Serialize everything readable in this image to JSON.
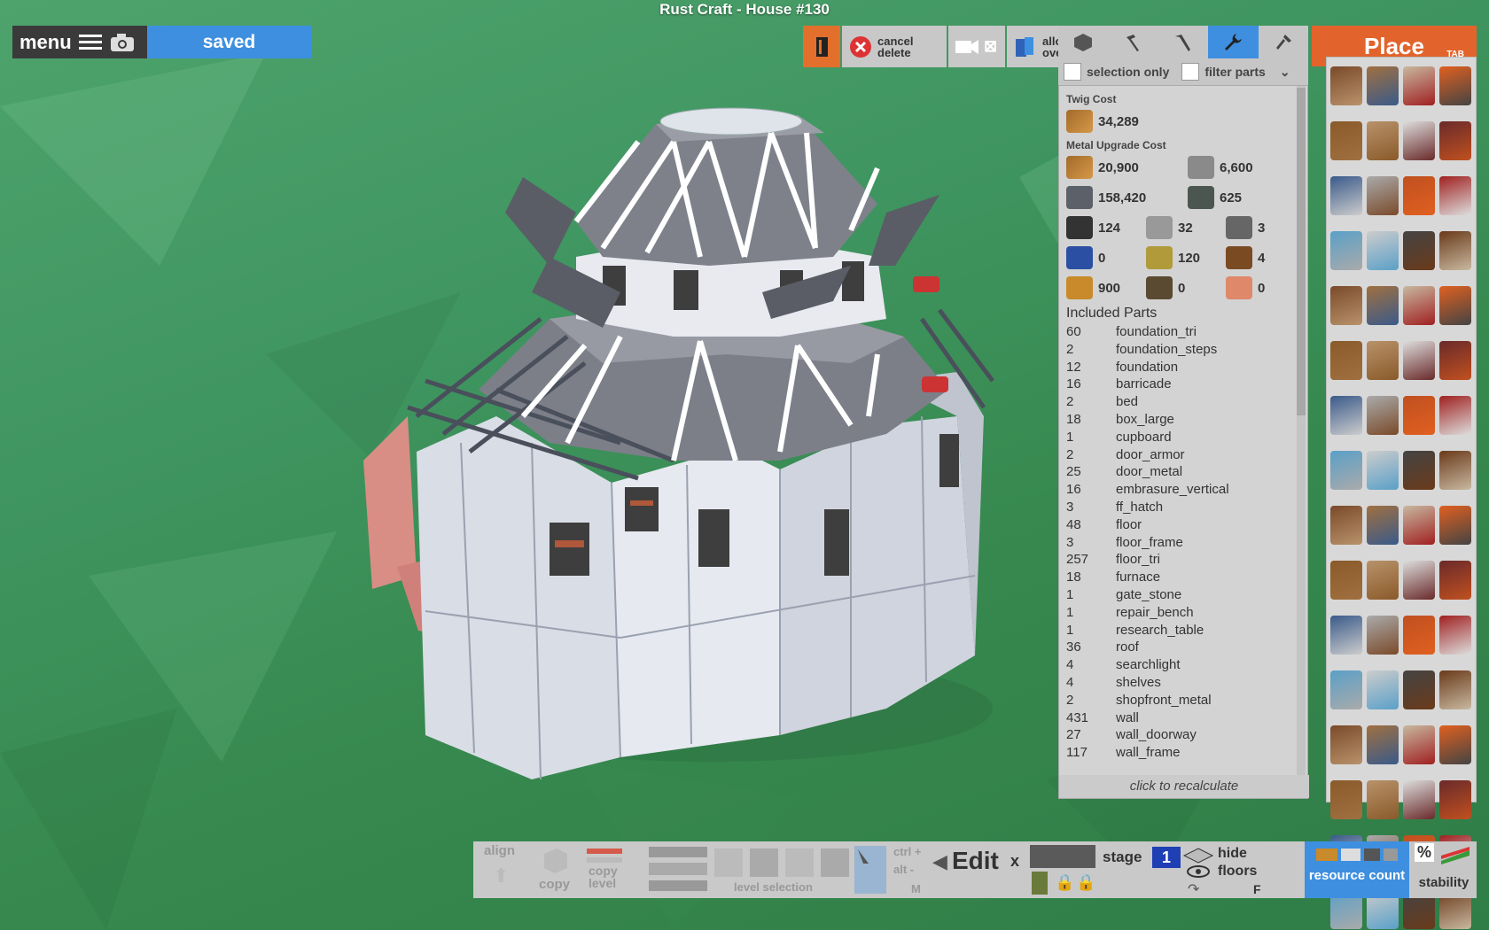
{
  "window": {
    "title": "Rust Craft - House #130"
  },
  "menu": {
    "label": "menu",
    "status": "saved"
  },
  "toolbar": {
    "cancel_delete": "cancel delete",
    "allow_overlap": "allow overlap"
  },
  "filters": {
    "selection_only": "selection only",
    "filter_parts": "filter parts"
  },
  "costs": {
    "twig_heading": "Twig Cost",
    "twig_value": "34,289",
    "metal_heading": "Metal Upgrade Cost",
    "metal": [
      {
        "icon": "wood-icon",
        "value": "20,900"
      },
      {
        "icon": "stone-icon",
        "value": "6,600"
      },
      {
        "icon": "metal-fragments-icon",
        "value": "158,420"
      },
      {
        "icon": "hq-metal-icon",
        "value": "625"
      }
    ],
    "components": [
      {
        "icon": "gear-icon",
        "value": "124"
      },
      {
        "icon": "blade-icon",
        "value": "32"
      },
      {
        "icon": "rope-ladder-icon",
        "value": "3"
      },
      {
        "icon": "tarp-icon",
        "value": "0"
      },
      {
        "icon": "cloth-icon",
        "value": "120"
      },
      {
        "icon": "spring-icon",
        "value": "4"
      },
      {
        "icon": "low-grade-fuel-icon",
        "value": "900"
      },
      {
        "icon": "rope-icon",
        "value": "0"
      },
      {
        "icon": "leather-icon",
        "value": "0"
      }
    ]
  },
  "parts": {
    "heading": "Included Parts",
    "items": [
      {
        "count": "60",
        "name": "foundation_tri"
      },
      {
        "count": "2",
        "name": "foundation_steps"
      },
      {
        "count": "12",
        "name": "foundation"
      },
      {
        "count": "16",
        "name": "barricade"
      },
      {
        "count": "2",
        "name": "bed"
      },
      {
        "count": "18",
        "name": "box_large"
      },
      {
        "count": "1",
        "name": "cupboard"
      },
      {
        "count": "2",
        "name": "door_armor"
      },
      {
        "count": "25",
        "name": "door_metal"
      },
      {
        "count": "16",
        "name": "embrasure_vertical"
      },
      {
        "count": "3",
        "name": "ff_hatch"
      },
      {
        "count": "48",
        "name": "floor"
      },
      {
        "count": "3",
        "name": "floor_frame"
      },
      {
        "count": "257",
        "name": "floor_tri"
      },
      {
        "count": "18",
        "name": "furnace"
      },
      {
        "count": "1",
        "name": "gate_stone"
      },
      {
        "count": "1",
        "name": "repair_bench"
      },
      {
        "count": "1",
        "name": "research_table"
      },
      {
        "count": "36",
        "name": "roof"
      },
      {
        "count": "4",
        "name": "searchlight"
      },
      {
        "count": "4",
        "name": "shelves"
      },
      {
        "count": "2",
        "name": "shopfront_metal"
      },
      {
        "count": "431",
        "name": "wall"
      },
      {
        "count": "27",
        "name": "wall_doorway"
      },
      {
        "count": "117",
        "name": "wall_frame"
      }
    ],
    "recalc": "click to recalculate"
  },
  "place": {
    "title": "Place",
    "hotkey": "TAB",
    "items": [
      "door-icon",
      "log-icon",
      "bed-icon",
      "campfire-icon",
      "small-box-icon",
      "large-box-icon",
      "shelves-icon",
      "chair-icon",
      "cupboard-icon",
      "ceiling-light-icon",
      "lantern-icon",
      "lamp-icon",
      "fridge-icon",
      "locker-icon",
      "workbench-icon",
      "furnace-icon",
      "bookcase-icon",
      "vending-machine-icon",
      "computer-station-icon",
      "table-icon",
      "wood-sign-icon",
      "banner-icon",
      "long-table-icon",
      "rocking-chair-icon",
      "fireplace-icon",
      "chimney-icon",
      "bbq-icon",
      "large-furnace-icon",
      "searchlight-icon",
      "turret-icon",
      "repair-bench-icon",
      "research-table-icon",
      "wood-wall-icon",
      "metal-wall-icon",
      "gate-icon",
      "stand-icon",
      "spikes-icon",
      "barricade-icon",
      "wood-barricade-icon",
      "spike-trap-icon",
      "sandbag-icon",
      "metal-crate-icon",
      "hay-bale-icon",
      "rug-icon",
      "rope-icon",
      "auto-turret-icon",
      "spooky-icon",
      "mounted-gun-icon",
      "plank-icon",
      "wood-piece-icon",
      "wood-block-icon",
      "log-pile-icon",
      "shutters-icon",
      "window-bars-icon",
      "floor-grill-icon",
      "hatch-icon",
      "drawers-icon",
      "glass-icon",
      "reinforced-glass-icon",
      "metal-window-icon",
      "lights-icon",
      "mirror-icon",
      "bear-rug-icon",
      "ladder-icon"
    ]
  },
  "bottom": {
    "align": "align",
    "copy": "copy",
    "copy_level": "copy level",
    "level_selection": "level selection",
    "ctrl_plus": "ctrl +",
    "alt_minus": "alt -",
    "m_key": "M",
    "edit": "Edit",
    "x_key": "x",
    "stage_label": "stage",
    "stage_value": "1",
    "hide_floors": "hide floors",
    "f_key": "F",
    "resource_count": "resource count",
    "percent": "%",
    "stability": "stability"
  },
  "colors": {
    "accent_blue": "#3e8fe0",
    "place_orange": "#e2642c",
    "stage_blue": "#1f3fb5",
    "panel_gray": "#d3d3d3",
    "ground_green": "#3f9560"
  }
}
